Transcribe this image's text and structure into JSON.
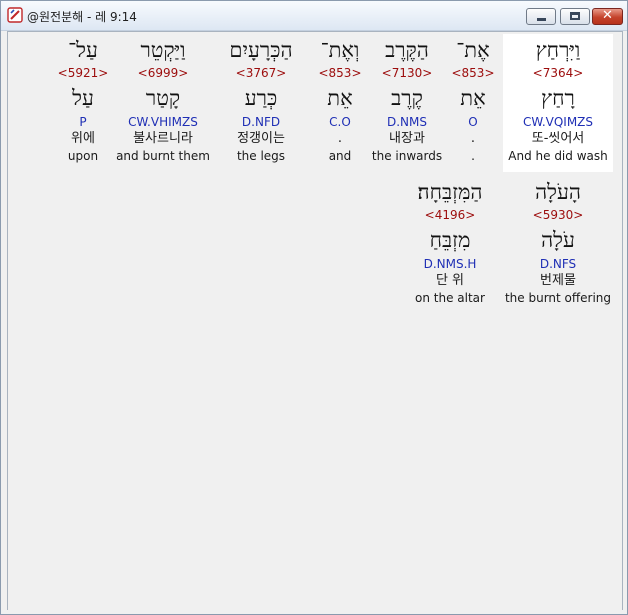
{
  "window": {
    "title": "@원전분해 - 레 9:14"
  },
  "words": [
    {
      "hebrew": "וַיִּרְחַץ",
      "strong": "<7364>",
      "lemma": "רָחַץ",
      "morph": "CW.VQIMZS",
      "korean": "또-씻어서",
      "english": "And he did wash"
    },
    {
      "hebrew": "אֶת־",
      "strong": "<853>",
      "lemma": "אֵת",
      "morph": "O",
      "korean": ".",
      "english": "."
    },
    {
      "hebrew": "הַקֶּרֶב",
      "strong": "<7130>",
      "lemma": "קֶרֶב",
      "morph": "D.NMS",
      "korean": "내장과",
      "english": "the inwards"
    },
    {
      "hebrew": "וְאֶת־",
      "strong": "<853>",
      "lemma": "אֵת",
      "morph": "C.O",
      "korean": ".",
      "english": "and"
    },
    {
      "hebrew": "הַכְּרָעָיִם",
      "strong": "<3767>",
      "lemma": "כְּרַע",
      "morph": "D.NFD",
      "korean": "정갱이는",
      "english": "the legs"
    },
    {
      "hebrew": "וַיַּקְטֵר",
      "strong": "<6999>",
      "lemma": "קָטַר",
      "morph": "CW.VHIMZS",
      "korean": "불사르니라",
      "english": "and burnt them"
    },
    {
      "hebrew": "עַל־",
      "strong": "<5921>",
      "lemma": "עַל",
      "morph": "P",
      "korean": "위에",
      "english": "upon"
    },
    {
      "hebrew": "הָעֹלָה",
      "strong": "<5930>",
      "lemma": "עֹלָה",
      "morph": "D.NFS",
      "korean": "번제물",
      "english": "the burnt offering"
    },
    {
      "hebrew": "הַמִּזְבֵּחָה׃",
      "strong": "<4196>",
      "lemma": "מִזְבֵּחַ",
      "morph": "D.NMS.H",
      "korean": "단 위",
      "english": "on the altar"
    }
  ]
}
